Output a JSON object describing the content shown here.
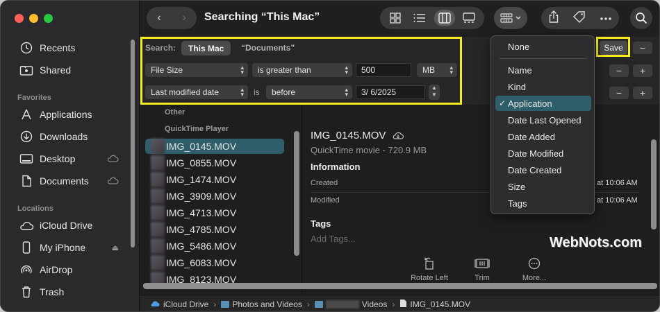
{
  "window": {
    "title": "Searching “This Mac”",
    "nav_back": "‹",
    "nav_forward": "›"
  },
  "sidebar": {
    "top_items": [
      {
        "label": "Recents",
        "icon": "clock-icon"
      },
      {
        "label": "Shared",
        "icon": "shared-folder-icon"
      }
    ],
    "favorites_header": "Favorites",
    "favorites": [
      {
        "label": "Applications",
        "icon": "applications-icon"
      },
      {
        "label": "Downloads",
        "icon": "download-icon"
      },
      {
        "label": "Desktop",
        "icon": "desktop-icon",
        "cloud": true
      },
      {
        "label": "Documents",
        "icon": "document-icon",
        "cloud": true
      }
    ],
    "locations_header": "Locations",
    "locations": [
      {
        "label": "iCloud Drive",
        "icon": "cloud-icon"
      },
      {
        "label": "My iPhone",
        "icon": "iphone-icon",
        "eject": "⏏"
      },
      {
        "label": "AirDrop",
        "icon": "airdrop-icon"
      },
      {
        "label": "Trash",
        "icon": "trash-icon"
      }
    ]
  },
  "search": {
    "label": "Search:",
    "scope_selected": "This Mac",
    "scope_other": "“Documents”",
    "save_label": "Save",
    "rules": [
      {
        "attribute": "File Size",
        "operator": "is greater than",
        "value": "500",
        "unit": "MB"
      },
      {
        "attribute": "Last modified date",
        "is_label": "is",
        "operator": "before",
        "value": "3/  6/2025"
      }
    ]
  },
  "file_list": {
    "group_other": "Other",
    "group_qt": "QuickTime Player",
    "files": [
      "IMG_0145.MOV",
      "IMG_0855.MOV",
      "IMG_1474.MOV",
      "IMG_3909.MOV",
      "IMG_4713.MOV",
      "IMG_4785.MOV",
      "IMG_5486.MOV",
      "IMG_6083.MOV",
      "IMG_8123.MOV"
    ],
    "selected": "IMG_0145.MOV"
  },
  "preview": {
    "name": "IMG_0145.MOV",
    "kind": "QuickTime movie - 720.9 MB",
    "info_header": "Information",
    "created_label": "Created",
    "created_value": "at 10:06 AM",
    "modified_label": "Modified",
    "modified_value": "at 10:06 AM",
    "tags_header": "Tags",
    "add_tags": "Add Tags...",
    "actions": [
      "Rotate Left",
      "Trim",
      "More..."
    ]
  },
  "sort_menu": {
    "none": "None",
    "items": [
      "Name",
      "Kind",
      "Application",
      "Date Last Opened",
      "Date Added",
      "Date Modified",
      "Date Created",
      "Size",
      "Tags"
    ],
    "selected": "Application",
    "check": "✓"
  },
  "path_bar": [
    "iCloud Drive",
    "Photos and Videos",
    "Videos",
    "IMG_0145.MOV"
  ],
  "watermark": "WebNots.com",
  "colors": {
    "highlight": "#f4ec1e",
    "selection": "#2e5e69"
  }
}
